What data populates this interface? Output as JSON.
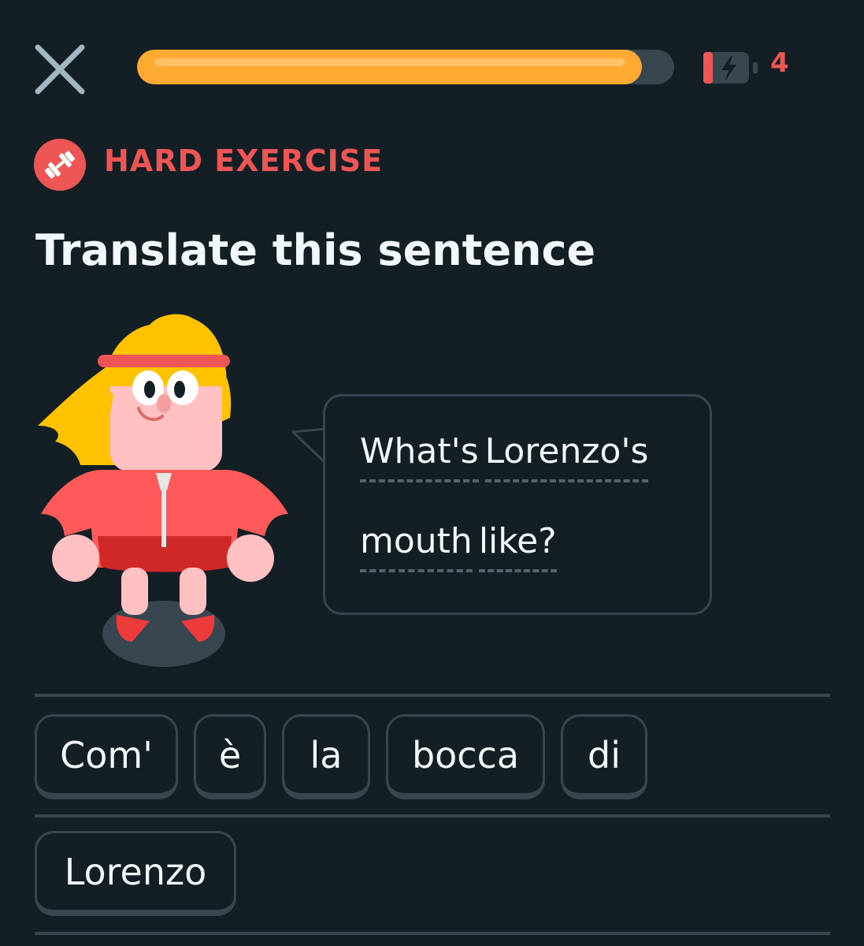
{
  "header": {
    "close_icon": "close-icon",
    "progress_fraction": 0.94,
    "progress_color": "#ffab33",
    "energy_icon": "battery-lightning-icon",
    "energy_count": "4",
    "accent_color": "#ee5555"
  },
  "badge": {
    "icon": "dumbbell-icon",
    "label": "HARD EXERCISE"
  },
  "prompt": {
    "title": "Translate this sentence"
  },
  "speech": {
    "character_icon": "lily-character",
    "line1": [
      "What's",
      "Lorenzo's"
    ],
    "line2": [
      "mouth",
      "like?"
    ]
  },
  "word_bank": [
    "Com'",
    "è",
    "la",
    "bocca",
    "di",
    "Lorenzo"
  ]
}
